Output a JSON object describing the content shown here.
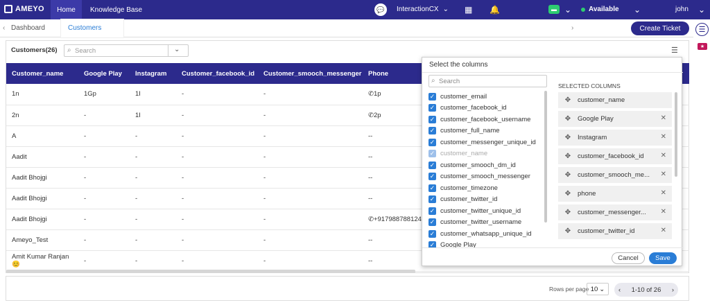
{
  "brand": "AMEYO",
  "nav": {
    "home": "Home",
    "knowledge_base": "Knowledge Base",
    "interaction": "InteractionCX",
    "status": "Available",
    "user": "john"
  },
  "breadcrumbs": {
    "dashboard": "Dashboard",
    "customers": "Customers"
  },
  "toolbar": {
    "create_ticket": "Create Ticket",
    "title": "Customers(26)",
    "search_placeholder": "Search"
  },
  "table": {
    "headers": [
      "Customer_name",
      "Google Play",
      "Instagram",
      "Customer_facebook_id",
      "Customer_smooch_messenger",
      "Phone"
    ],
    "rows": [
      [
        "1n",
        "1Gp",
        "1I",
        "-",
        "-",
        "1p"
      ],
      [
        "2n",
        "-",
        "1I",
        "-",
        "-",
        "2p"
      ],
      [
        "A",
        "-",
        "-",
        "-",
        "-",
        "--"
      ],
      [
        "Aadit",
        "-",
        "-",
        "-",
        "-",
        "--"
      ],
      [
        "Aadit Bhojgi",
        "-",
        "-",
        "-",
        "-",
        "--"
      ],
      [
        "Aadit Bhojgi",
        "-",
        "-",
        "-",
        "-",
        "--"
      ],
      [
        "Aadit Bhojgi",
        "-",
        "-",
        "-",
        "-",
        "+917988788124"
      ],
      [
        "Ameyo_Test",
        "-",
        "-",
        "-",
        "-",
        "--"
      ],
      [
        "Amit Kumar Ranjan 😊",
        "-",
        "-",
        "-",
        "-",
        "--"
      ]
    ]
  },
  "modal": {
    "title": "Select the columns",
    "search_placeholder": "Search",
    "available": [
      "customer_email",
      "customer_facebook_id",
      "customer_facebook_username",
      "customer_full_name",
      "customer_messenger_unique_id",
      "customer_name",
      "customer_smooch_dm_id",
      "customer_smooch_messenger",
      "customer_timezone",
      "customer_twitter_id",
      "customer_twitter_unique_id",
      "customer_twitter_username",
      "customer_whatsapp_unique_id",
      "Google Play"
    ],
    "selected_title": "SELECTED COLUMNS",
    "selected": [
      "customer_name",
      "Google Play",
      "Instagram",
      "customer_facebook_id",
      "customer_smooch_me...",
      "phone",
      "customer_messenger...",
      "customer_twitter_id"
    ],
    "cancel": "Cancel",
    "save": "Save"
  },
  "pagination": {
    "rows_label": "Rows per page",
    "rows_value": "10",
    "range": "1-10 of 26"
  },
  "colors": {
    "primary": "#2c2a8c",
    "accent": "#2a7dd6",
    "status_green": "#2ecc71"
  }
}
